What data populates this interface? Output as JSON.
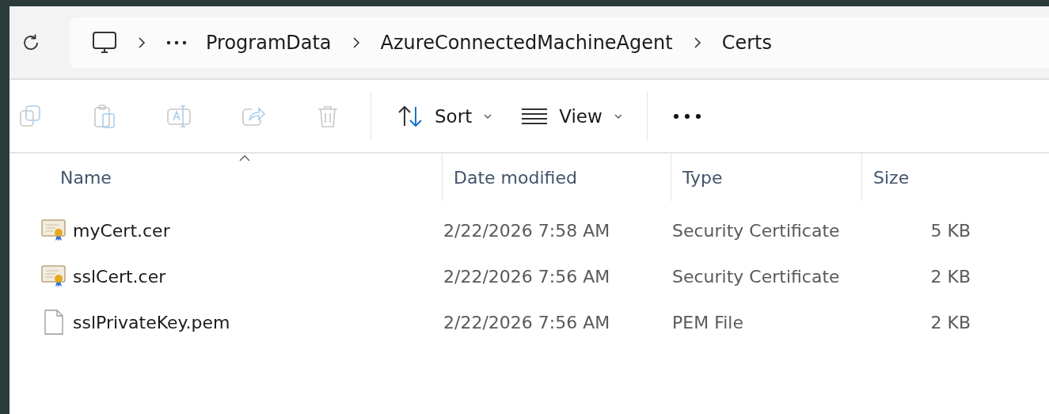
{
  "breadcrumb": {
    "items": [
      "ProgramData",
      "AzureConnectedMachineAgent",
      "Certs"
    ]
  },
  "toolbar": {
    "actions": [
      {
        "kind": "copy",
        "disabled": true
      },
      {
        "kind": "paste",
        "disabled": true
      },
      {
        "kind": "rename",
        "disabled": true
      },
      {
        "kind": "share",
        "disabled": true
      },
      {
        "kind": "delete",
        "disabled": true
      }
    ],
    "sort_button": "Sort",
    "view_button": "View"
  },
  "table": {
    "columns": [
      {
        "label": "Name",
        "sorted": true
      },
      {
        "label": "Date modified",
        "sorted": false
      },
      {
        "label": "Type",
        "sorted": false
      },
      {
        "label": "Size",
        "sorted": false
      }
    ],
    "rows": [
      {
        "kind": "certificate",
        "name": "myCert.cer",
        "date": "2/22/2026 7:58 AM",
        "type": "Security Certificate",
        "size": "5 KB"
      },
      {
        "kind": "certificate",
        "name": "sslCert.cer",
        "date": "2/22/2026 7:56 AM",
        "type": "Security Certificate",
        "size": "2 KB"
      },
      {
        "kind": "file",
        "name": "sslPrivateKey.pem",
        "date": "2/22/2026 7:56 AM",
        "type": "PEM File",
        "size": "2 KB"
      }
    ]
  }
}
